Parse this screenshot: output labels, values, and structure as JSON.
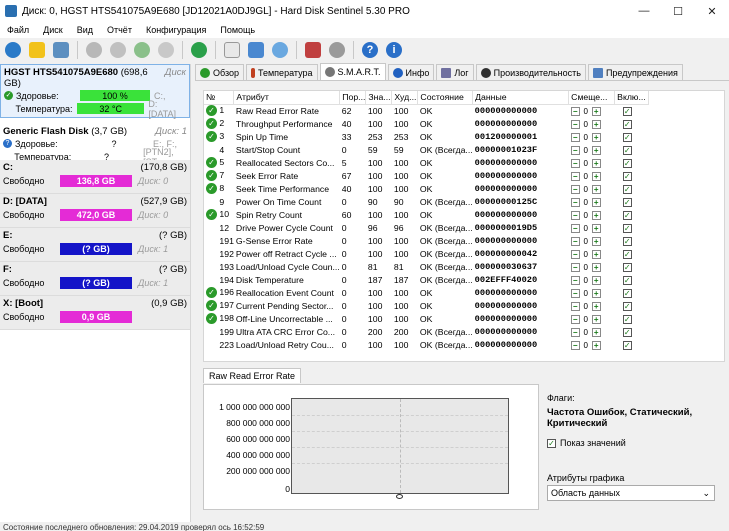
{
  "window": {
    "title": "Диск: 0, HGST HTS541075A9E680 [JD12021A0DJ9GL]  -  Hard Disk Sentinel 5.30 PRO",
    "min": "—",
    "max": "☐",
    "close": "✕"
  },
  "menu": [
    "Файл",
    "Диск",
    "Вид",
    "Отчёт",
    "Конфигурация",
    "Помощь"
  ],
  "disks": [
    {
      "name": "HGST HTS541075A9E680",
      "size": "(698,6 GB)",
      "disk_no": "Диск",
      "health_label": "Здоровье:",
      "health": "100 %",
      "temp_label": "Температура:",
      "temp": "32 °C",
      "vols1": "C:,",
      "vols2": "D: [DATA]"
    },
    {
      "name": "Generic Flash Disk",
      "size": "(3,7 GB)",
      "disk_no": "Диск: 1",
      "health_label": "Здоровье:",
      "health": "?",
      "temp_label": "Температура:",
      "temp": "?",
      "vols1": "E:, F:,",
      "vols2": "[PTN2],  [ST"
    }
  ],
  "volumes": [
    {
      "name": "C:",
      "size": "(170,8 GB)",
      "free_label": "Свободно",
      "free": "136,8 GB",
      "disk": "Диск: 0",
      "color": "#e42bd6"
    },
    {
      "name": "D: [DATA]",
      "size": "(527,9 GB)",
      "free_label": "Свободно",
      "free": "472,0 GB",
      "disk": "Диск: 0",
      "color": "#e42bd6"
    },
    {
      "name": "E:",
      "size": "(? GB)",
      "free_label": "Свободно",
      "free": "(? GB)",
      "disk": "Диск: 1",
      "color": "#1414c8"
    },
    {
      "name": "F:",
      "size": "(? GB)",
      "free_label": "Свободно",
      "free": "(? GB)",
      "disk": "Диск: 1",
      "color": "#1414c8"
    },
    {
      "name": "X: [Boot]",
      "size": "(0,9 GB)",
      "free_label": "Свободно",
      "free": "0,9 GB",
      "disk": "",
      "color": "#e42bd6"
    }
  ],
  "tabs": [
    {
      "label": "Обзор",
      "color": "#2a9a2a"
    },
    {
      "label": "Температура",
      "color": "#c04020"
    },
    {
      "label": "S.M.A.R.T.",
      "color": "#777777"
    },
    {
      "label": "Инфо",
      "color": "#2060c0"
    },
    {
      "label": "Лог",
      "color": "#7070a0"
    },
    {
      "label": "Производительность",
      "color": "#303030"
    },
    {
      "label": "Предупреждения",
      "color": "#5080c0"
    }
  ],
  "smart": {
    "headers": [
      "№",
      "Атрибут",
      "Пор...",
      "Зна...",
      "Худ...",
      "Состояние",
      "Данные",
      "Смеще...",
      "Вклю..."
    ],
    "rows": [
      {
        "ok": true,
        "id": "1",
        "attr": "Raw Read Error Rate",
        "thr": "62",
        "val": "100",
        "worst": "100",
        "state": "OK",
        "data": "000000000000",
        "offset": "0"
      },
      {
        "ok": true,
        "id": "2",
        "attr": "Throughput Performance",
        "thr": "40",
        "val": "100",
        "worst": "100",
        "state": "OK",
        "data": "000000000000",
        "offset": "0"
      },
      {
        "ok": true,
        "id": "3",
        "attr": "Spin Up Time",
        "thr": "33",
        "val": "253",
        "worst": "253",
        "state": "OK",
        "data": "001200000001",
        "offset": "0"
      },
      {
        "ok": false,
        "id": "4",
        "attr": "Start/Stop Count",
        "thr": "0",
        "val": "59",
        "worst": "59",
        "state": "OK (Всегда...",
        "data": "00000001023F",
        "offset": "0"
      },
      {
        "ok": true,
        "id": "5",
        "attr": "Reallocated Sectors Co...",
        "thr": "5",
        "val": "100",
        "worst": "100",
        "state": "OK",
        "data": "000000000000",
        "offset": "0"
      },
      {
        "ok": true,
        "id": "7",
        "attr": "Seek Error Rate",
        "thr": "67",
        "val": "100",
        "worst": "100",
        "state": "OK",
        "data": "000000000000",
        "offset": "0"
      },
      {
        "ok": true,
        "id": "8",
        "attr": "Seek Time Performance",
        "thr": "40",
        "val": "100",
        "worst": "100",
        "state": "OK",
        "data": "000000000000",
        "offset": "0"
      },
      {
        "ok": false,
        "id": "9",
        "attr": "Power On Time Count",
        "thr": "0",
        "val": "90",
        "worst": "90",
        "state": "OK (Всегда...",
        "data": "00000000125C",
        "offset": "0"
      },
      {
        "ok": true,
        "id": "10",
        "attr": "Spin Retry Count",
        "thr": "60",
        "val": "100",
        "worst": "100",
        "state": "OK",
        "data": "000000000000",
        "offset": "0"
      },
      {
        "ok": false,
        "id": "12",
        "attr": "Drive Power Cycle Count",
        "thr": "0",
        "val": "96",
        "worst": "96",
        "state": "OK (Всегда...",
        "data": "0000000019D5",
        "offset": "0"
      },
      {
        "ok": false,
        "id": "191",
        "attr": "G-Sense Error Rate",
        "thr": "0",
        "val": "100",
        "worst": "100",
        "state": "OK (Всегда...",
        "data": "000000000000",
        "offset": "0"
      },
      {
        "ok": false,
        "id": "192",
        "attr": "Power off Retract Cycle ...",
        "thr": "0",
        "val": "100",
        "worst": "100",
        "state": "OK (Всегда...",
        "data": "000000000042",
        "offset": "0"
      },
      {
        "ok": false,
        "id": "193",
        "attr": "Load/Unload Cycle Coun...",
        "thr": "0",
        "val": "81",
        "worst": "81",
        "state": "OK (Всегда...",
        "data": "000000030637",
        "offset": "0"
      },
      {
        "ok": false,
        "id": "194",
        "attr": "Disk Temperature",
        "thr": "0",
        "val": "187",
        "worst": "187",
        "state": "OK (Всегда...",
        "data": "002EFFF40020",
        "offset": "0"
      },
      {
        "ok": true,
        "id": "196",
        "attr": "Reallocation Event Count",
        "thr": "0",
        "val": "100",
        "worst": "100",
        "state": "OK",
        "data": "000000000000",
        "offset": "0"
      },
      {
        "ok": true,
        "id": "197",
        "attr": "Current Pending Sector...",
        "thr": "0",
        "val": "100",
        "worst": "100",
        "state": "OK",
        "data": "000000000000",
        "offset": "0"
      },
      {
        "ok": true,
        "id": "198",
        "attr": "Off-Line Uncorrectable ...",
        "thr": "0",
        "val": "100",
        "worst": "100",
        "state": "OK",
        "data": "000000000000",
        "offset": "0"
      },
      {
        "ok": false,
        "id": "199",
        "attr": "Ultra ATA CRC Error Co...",
        "thr": "0",
        "val": "200",
        "worst": "200",
        "state": "OK (Всегда...",
        "data": "000000000000",
        "offset": "0"
      },
      {
        "ok": false,
        "id": "223",
        "attr": "Load/Unload Retry Cou...",
        "thr": "0",
        "val": "100",
        "worst": "100",
        "state": "OK (Всегда...",
        "data": "000000000000",
        "offset": "0"
      }
    ]
  },
  "graph": {
    "tab": "Raw Read Error Rate",
    "y_ticks": [
      "1 000 000 000 000",
      "800 000 000 000",
      "600 000 000 000",
      "400 000 000 000",
      "200 000 000 000",
      "0"
    ],
    "flags_label": "Флаги:",
    "flags_value": "Частота Ошибок, Статический, Критический",
    "show_values": "Показ значений",
    "attr_label": "Атрибуты графика",
    "attr_select": "Область данных"
  },
  "status": "Состояние последнего обновления: 29.04.2019 проверял ось 16:52:59"
}
